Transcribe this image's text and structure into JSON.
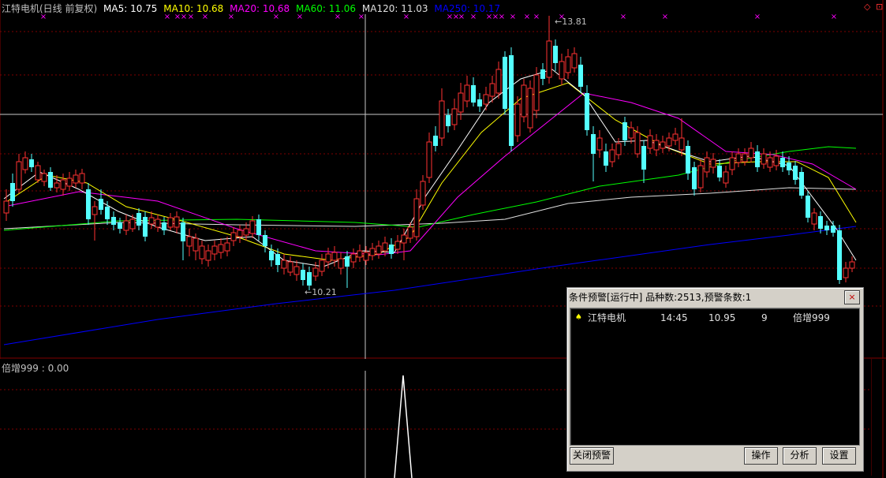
{
  "legend": {
    "stock_title": "江特电机(日线 前复权)",
    "ma": [
      {
        "label": "MA5: 10.75",
        "color": "#ffffff"
      },
      {
        "label": "MA10: 10.68",
        "color": "#ffff00"
      },
      {
        "label": "MA20: 10.68",
        "color": "#ff00ff"
      },
      {
        "label": "MA60: 11.06",
        "color": "#00ff00"
      },
      {
        "label": "MA120: 11.03",
        "color": "#e0e0e0"
      },
      {
        "label": "MA250: 10.17",
        "color": "#0000ff"
      }
    ]
  },
  "indicator": {
    "label": "倍增999 : 0.00"
  },
  "annotations": {
    "high": "13.81",
    "low": "10.21"
  },
  "alert_window": {
    "title": "条件预警[运行中] 品种数:2513,预警条数:1",
    "close_glyph": "×",
    "row": {
      "name": "江特电机",
      "time": "14:45",
      "price": "10.95",
      "count": "9",
      "condition": "倍增999"
    },
    "buttons": {
      "close_alert": "关闭预警",
      "operate": "操作",
      "analyze": "分析",
      "settings": "设置"
    }
  },
  "colors": {
    "up": "#ff3232",
    "down": "#54ffff",
    "grid": "#7f0000",
    "marker": "#ff00ff",
    "crosshair": "#c8c8c8"
  },
  "chart_data": {
    "type": "candlestick",
    "high_marker": 13.81,
    "low_marker": 10.21,
    "ma_current": {
      "MA5": 10.75,
      "MA10": 10.68,
      "MA20": 10.68,
      "MA60": 11.06,
      "MA120": 11.03,
      "MA250": 10.17
    },
    "indicator_value": 0.0
  }
}
